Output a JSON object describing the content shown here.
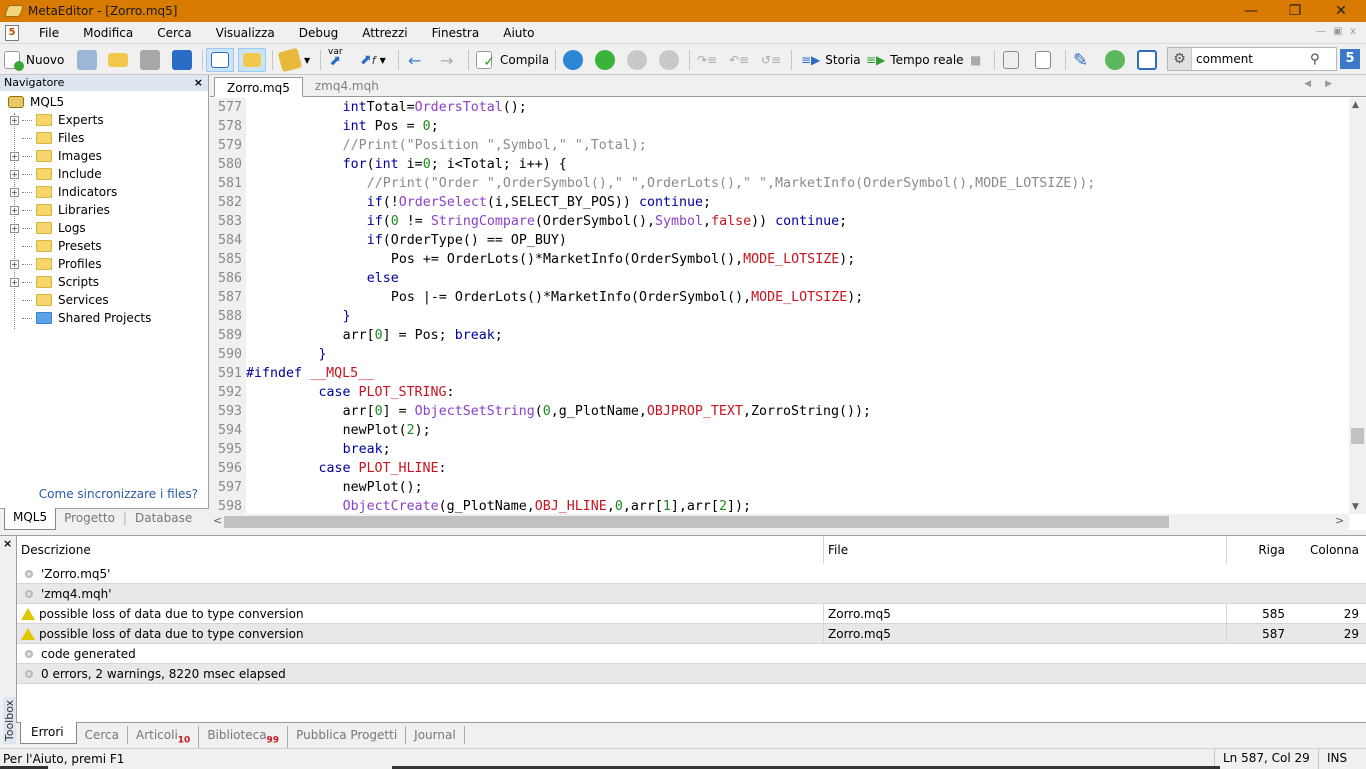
{
  "window": {
    "title": "MetaEditor - [Zorro.mq5]",
    "controls": [
      "minimize",
      "restore",
      "close"
    ]
  },
  "menu": {
    "items": [
      "File",
      "Modifica",
      "Cerca",
      "Visualizza",
      "Debug",
      "Attrezzi",
      "Finestra",
      "Aiuto"
    ]
  },
  "toolbar": {
    "new_label": "Nuovo",
    "compile_label": "Compila",
    "history_label": "Storia",
    "realtime_label": "Tempo reale",
    "var_label": "var",
    "search_value": "comment"
  },
  "navigator": {
    "title": "Navigatore",
    "root": "MQL5",
    "items": [
      {
        "label": "Experts",
        "expandable": true
      },
      {
        "label": "Files",
        "expandable": false
      },
      {
        "label": "Images",
        "expandable": true
      },
      {
        "label": "Include",
        "expandable": true
      },
      {
        "label": "Indicators",
        "expandable": true
      },
      {
        "label": "Libraries",
        "expandable": true
      },
      {
        "label": "Logs",
        "expandable": true
      },
      {
        "label": "Presets",
        "expandable": false
      },
      {
        "label": "Profiles",
        "expandable": true
      },
      {
        "label": "Scripts",
        "expandable": true
      },
      {
        "label": "Services",
        "expandable": false
      },
      {
        "label": "Shared Projects",
        "expandable": false
      }
    ],
    "sync_link": "Come sincronizzare i files?",
    "tabs": [
      "MQL5",
      "Progetto",
      "Database"
    ],
    "active_tab": "MQL5"
  },
  "editor": {
    "tabs": [
      "Zorro.mq5",
      "zmq4.mqh"
    ],
    "active_tab": "Zorro.mq5",
    "lines": [
      {
        "n": "577",
        "indent": 12,
        "tokens": [
          [
            "kw",
            "int"
          ],
          [
            "",
            "Total="
          ],
          [
            "fn",
            "OrdersTotal"
          ],
          [
            "",
            "();"
          ]
        ]
      },
      {
        "n": "578",
        "indent": 12,
        "tokens": [
          [
            "kw",
            "int"
          ],
          [
            "",
            " Pos = "
          ],
          [
            "num",
            "0"
          ],
          [
            "",
            ";"
          ]
        ]
      },
      {
        "n": "579",
        "indent": 12,
        "tokens": [
          [
            "cm",
            "//Print(\"Position \",Symbol,\" \",Total);"
          ]
        ]
      },
      {
        "n": "580",
        "indent": 12,
        "tokens": [
          [
            "kw",
            "for"
          ],
          [
            "",
            "("
          ],
          [
            "kw",
            "int"
          ],
          [
            "",
            " i="
          ],
          [
            "num",
            "0"
          ],
          [
            "",
            "; i<Total; i++) {"
          ]
        ]
      },
      {
        "n": "581",
        "indent": 15,
        "tokens": [
          [
            "cm",
            "//Print(\"Order \",OrderSymbol(),\" \",OrderLots(),\" \",MarketInfo(OrderSymbol(),MODE_LOTSIZE));"
          ]
        ]
      },
      {
        "n": "582",
        "indent": 15,
        "tokens": [
          [
            "kw",
            "if"
          ],
          [
            "",
            "(!"
          ],
          [
            "fn",
            "OrderSelect"
          ],
          [
            "",
            "(i,SELECT_BY_POS)) "
          ],
          [
            "kw",
            "continue"
          ],
          [
            "",
            ";"
          ]
        ]
      },
      {
        "n": "583",
        "indent": 15,
        "tokens": [
          [
            "kw",
            "if"
          ],
          [
            "",
            "("
          ],
          [
            "num",
            "0"
          ],
          [
            "",
            " != "
          ],
          [
            "fn",
            "StringCompare"
          ],
          [
            "",
            "(OrderSymbol(),"
          ],
          [
            "fn",
            "Symbol"
          ],
          [
            "",
            ","
          ],
          [
            "cst",
            "false"
          ],
          [
            "",
            "))"
          ],
          [
            "kw",
            " continue"
          ],
          [
            "",
            ";"
          ]
        ]
      },
      {
        "n": "584",
        "indent": 15,
        "tokens": [
          [
            "kw",
            "if"
          ],
          [
            "",
            "(OrderType() == OP_BUY)"
          ]
        ]
      },
      {
        "n": "585",
        "indent": 18,
        "tokens": [
          [
            "",
            "Pos += OrderLots()*MarketInfo(OrderSymbol(),"
          ],
          [
            "cst",
            "MODE_LOTSIZE"
          ],
          [
            "",
            ");"
          ]
        ]
      },
      {
        "n": "586",
        "indent": 15,
        "tokens": [
          [
            "kw",
            "else"
          ]
        ]
      },
      {
        "n": "587",
        "indent": 18,
        "tokens": [
          [
            "",
            "Pos |-= OrderLots()*MarketInfo(OrderSymbol(),"
          ],
          [
            "cst",
            "MODE_LOTSIZE"
          ],
          [
            "",
            ");"
          ]
        ]
      },
      {
        "n": "588",
        "indent": 12,
        "tokens": [
          [
            "kw",
            "}"
          ]
        ]
      },
      {
        "n": "589",
        "indent": 12,
        "tokens": [
          [
            "",
            "arr["
          ],
          [
            "num",
            "0"
          ],
          [
            "",
            "] = Pos; "
          ],
          [
            "kw",
            "break"
          ],
          [
            "",
            ";"
          ]
        ]
      },
      {
        "n": "590",
        "indent": 9,
        "tokens": [
          [
            "kw",
            "}"
          ]
        ]
      },
      {
        "n": "591",
        "indent": 0,
        "tokens": [
          [
            "pp",
            "#ifndef"
          ],
          [
            "",
            " "
          ],
          [
            "cst",
            "__MQL5__"
          ]
        ]
      },
      {
        "n": "592",
        "indent": 9,
        "tokens": [
          [
            "kw",
            "case"
          ],
          [
            "",
            " "
          ],
          [
            "cst",
            "PLOT_STRING"
          ],
          [
            "",
            ":"
          ]
        ]
      },
      {
        "n": "593",
        "indent": 12,
        "tokens": [
          [
            "",
            "arr["
          ],
          [
            "num",
            "0"
          ],
          [
            "",
            "] = "
          ],
          [
            "fn",
            "ObjectSetString"
          ],
          [
            "",
            "("
          ],
          [
            "num",
            "0"
          ],
          [
            "",
            ",g_PlotName,"
          ],
          [
            "cst",
            "OBJPROP_TEXT"
          ],
          [
            "",
            ",ZorroString());"
          ]
        ]
      },
      {
        "n": "594",
        "indent": 12,
        "tokens": [
          [
            "",
            "newPlot("
          ],
          [
            "num",
            "2"
          ],
          [
            "",
            ");"
          ]
        ]
      },
      {
        "n": "595",
        "indent": 12,
        "tokens": [
          [
            "kw",
            "break"
          ],
          [
            "",
            ";"
          ]
        ]
      },
      {
        "n": "596",
        "indent": 9,
        "tokens": [
          [
            "kw",
            "case"
          ],
          [
            "",
            " "
          ],
          [
            "cst",
            "PLOT_HLINE"
          ],
          [
            "",
            ":"
          ]
        ]
      },
      {
        "n": "597",
        "indent": 12,
        "tokens": [
          [
            "",
            "newPlot();"
          ]
        ]
      },
      {
        "n": "598",
        "indent": 12,
        "tokens": [
          [
            "fn",
            "ObjectCreate"
          ],
          [
            "",
            "(g_PlotName,"
          ],
          [
            "cst",
            "OBJ_HLINE"
          ],
          [
            "",
            ","
          ],
          [
            "num",
            "0"
          ],
          [
            "",
            ",arr["
          ],
          [
            "num",
            "1"
          ],
          [
            "",
            "],arr["
          ],
          [
            "num",
            "2"
          ],
          [
            "",
            "]);"
          ]
        ]
      }
    ]
  },
  "toolbox": {
    "label": "Toolbox",
    "columns": [
      "Descrizione",
      "File",
      "Riga",
      "Colonna"
    ],
    "rows": [
      {
        "icon": "info",
        "desc": "'Zorro.mq5'",
        "file": "",
        "riga": "",
        "colonna": ""
      },
      {
        "icon": "info",
        "desc": "'zmq4.mqh'",
        "file": "",
        "riga": "",
        "colonna": ""
      },
      {
        "icon": "warning",
        "desc": "possible loss of data due to type conversion",
        "file": "Zorro.mq5",
        "riga": "585",
        "colonna": "29"
      },
      {
        "icon": "warning",
        "desc": "possible loss of data due to type conversion",
        "file": "Zorro.mq5",
        "riga": "587",
        "colonna": "29"
      },
      {
        "icon": "info",
        "desc": "code generated",
        "file": "",
        "riga": "",
        "colonna": ""
      },
      {
        "icon": "info",
        "desc": "0 errors, 2 warnings, 8220 msec elapsed",
        "file": "",
        "riga": "",
        "colonna": ""
      }
    ],
    "tabs": [
      {
        "label": "Errori",
        "badge": ""
      },
      {
        "label": "Cerca",
        "badge": ""
      },
      {
        "label": "Articoli",
        "badge": "10"
      },
      {
        "label": "Biblioteca",
        "badge": "99"
      },
      {
        "label": "Pubblica Progetti",
        "badge": ""
      },
      {
        "label": "Journal",
        "badge": ""
      }
    ],
    "active_tab": "Errori"
  },
  "status": {
    "help": "Per l'Aiuto, premi F1",
    "position": "Ln 587, Col 29",
    "mode": "INS"
  }
}
